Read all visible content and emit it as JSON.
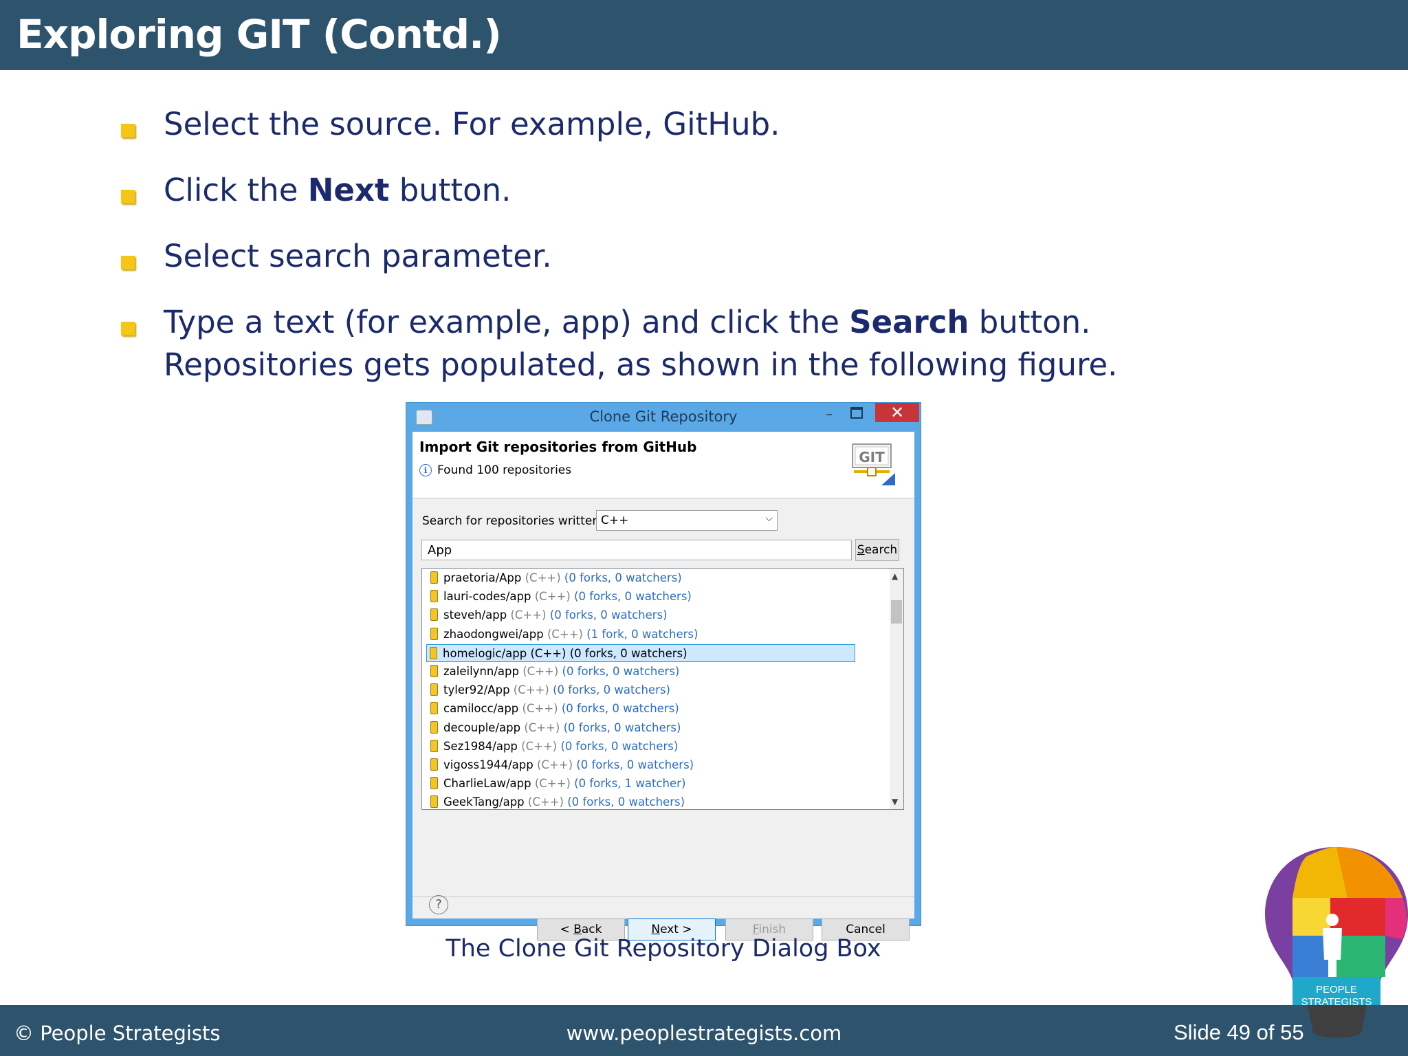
{
  "slide": {
    "title": "Exploring GIT (Contd.)",
    "bullets": [
      {
        "pre": "Select the source. For example, GitHub.",
        "bold": "",
        "post": ""
      },
      {
        "pre": "Click the ",
        "bold": "Next",
        "post": " button."
      },
      {
        "pre": "Select search parameter.",
        "bold": "",
        "post": ""
      },
      {
        "pre": "Type a text (for example, app) and click the ",
        "bold": "Search",
        "post": " button. Repositories gets populated, as shown in the following figure."
      }
    ],
    "caption": "The Clone Git Repository Dialog Box"
  },
  "dialog": {
    "title": "Clone Git Repository",
    "header_title": "Import Git repositories from GitHub",
    "info": "Found 100 repositories",
    "logo_text": "GIT",
    "search_label": "Search for repositories written in",
    "language": "C++",
    "query": "App",
    "search_button": "Search",
    "repos": [
      {
        "name": "praetoria/App",
        "lang": "(C++)",
        "stats": "(0 forks, 0 watchers)"
      },
      {
        "name": "lauri-codes/app",
        "lang": "(C++)",
        "stats": "(0 forks, 0 watchers)"
      },
      {
        "name": "steveh/app",
        "lang": "(C++)",
        "stats": "(0 forks, 0 watchers)"
      },
      {
        "name": "zhaodongwei/app",
        "lang": "(C++)",
        "stats": "(1 fork, 0 watchers)"
      },
      {
        "name": "homelogic/app",
        "lang": "(C++)",
        "stats": "(0 forks, 0 watchers)"
      },
      {
        "name": "zaleilynn/app",
        "lang": "(C++)",
        "stats": "(0 forks, 0 watchers)"
      },
      {
        "name": "tyler92/App",
        "lang": "(C++)",
        "stats": "(0 forks, 0 watchers)"
      },
      {
        "name": "camilocc/app",
        "lang": "(C++)",
        "stats": "(0 forks, 0 watchers)"
      },
      {
        "name": "decouple/app",
        "lang": "(C++)",
        "stats": "(0 forks, 0 watchers)"
      },
      {
        "name": "Sez1984/app",
        "lang": "(C++)",
        "stats": "(0 forks, 0 watchers)"
      },
      {
        "name": "vigoss1944/app",
        "lang": "(C++)",
        "stats": "(0 forks, 0 watchers)"
      },
      {
        "name": "CharlieLaw/app",
        "lang": "(C++)",
        "stats": "(0 forks, 1 watcher)"
      },
      {
        "name": "GeekTang/app",
        "lang": "(C++)",
        "stats": "(0 forks, 0 watchers)"
      }
    ],
    "selected_repo_index": 4,
    "buttons": {
      "back_prefix": "< ",
      "back_key": "B",
      "back_rest": "ack",
      "next_key": "N",
      "next_rest": "ext >",
      "finish_key": "F",
      "finish_rest": "inish",
      "cancel": "Cancel"
    },
    "help_icon": "question-icon"
  },
  "footer": {
    "copyright": "© People Strategists",
    "website": "www.peoplestrategists.com",
    "slide_number": "Slide 49 of 55"
  },
  "logo": {
    "line1": "PEOPLE",
    "line2": "STRATEGISTS"
  },
  "colors": {
    "header_bg": "#2e536d",
    "bullet": "#f5c518",
    "text": "#1a2a6c",
    "dialog_frame": "#5aa9e6",
    "close_button": "#c7343a",
    "link_blue": "#2a6cc7"
  }
}
